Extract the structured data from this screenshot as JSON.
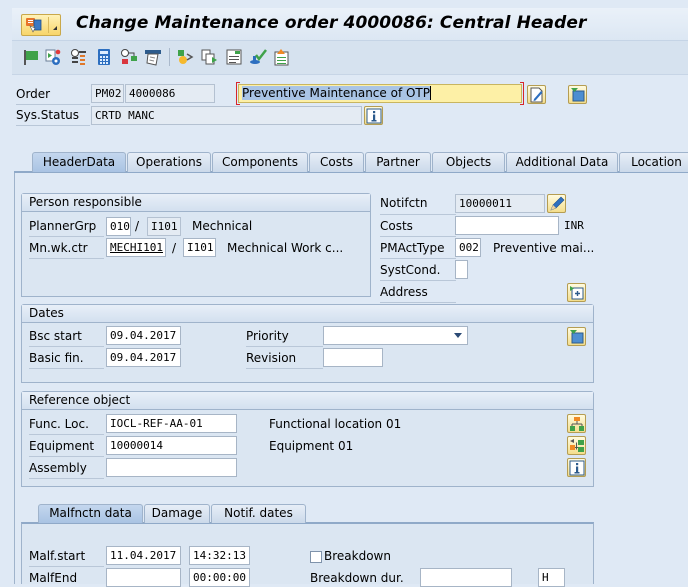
{
  "window": {
    "title": "Change Maintenance order 4000086: Central Header"
  },
  "toolbar": {
    "icons": [
      "flag-icon",
      "settings-gear-icon",
      "list-icon",
      "calculator-icon",
      "transfer-icon",
      "print-icon",
      "process-icon",
      "copy-icon",
      "document-icon",
      "approve-icon",
      "upload-document-icon"
    ]
  },
  "header": {
    "order_label": "Order",
    "order_type": "PM02",
    "order_number": "4000086",
    "order_description": "Preventive Maintenance of OTP",
    "sys_status_label": "Sys.Status",
    "sys_status_value": "CRTD MANC"
  },
  "tabs": [
    {
      "label": "HeaderData",
      "active": true
    },
    {
      "label": "Operations",
      "active": false
    },
    {
      "label": "Components",
      "active": false
    },
    {
      "label": "Costs",
      "active": false
    },
    {
      "label": "Partner",
      "active": false
    },
    {
      "label": "Objects",
      "active": false
    },
    {
      "label": "Additional Data",
      "active": false
    },
    {
      "label": "Location",
      "active": false
    }
  ],
  "person_responsible": {
    "title": "Person responsible",
    "planner_grp_label": "PlannerGrp",
    "planner_grp_value": "010",
    "planner_plant": "I101",
    "planner_desc": "Mechnical",
    "work_ctr_label": "Mn.wk.ctr",
    "work_ctr_value": "MECHI101",
    "work_ctr_plant": "I101",
    "work_ctr_desc": "Mechnical Work c...",
    "separator": "/"
  },
  "notification": {
    "notifctn_label": "Notifctn",
    "notifctn_value": "10000011",
    "costs_label": "Costs",
    "costs_value": "",
    "currency": "INR",
    "pmacttype_label": "PMActType",
    "pmacttype_value": "002",
    "pmacttype_desc": "Preventive mai...",
    "systcond_label": "SystCond.",
    "systcond_value": "",
    "address_label": "Address"
  },
  "dates": {
    "title": "Dates",
    "bsc_start_label": "Bsc start",
    "bsc_start_value": "09.04.2017",
    "basic_fin_label": "Basic fin.",
    "basic_fin_value": "09.04.2017",
    "priority_label": "Priority",
    "priority_value": "",
    "revision_label": "Revision",
    "revision_value": ""
  },
  "reference_object": {
    "title": "Reference object",
    "func_loc_label": "Func. Loc.",
    "func_loc_value": "IOCL-REF-AA-01",
    "func_loc_desc": "Functional location 01",
    "equipment_label": "Equipment",
    "equipment_value": "10000014",
    "equipment_desc": "Equipment 01",
    "assembly_label": "Assembly",
    "assembly_value": ""
  },
  "subtabs": [
    {
      "label": "Malfnctn data",
      "active": true
    },
    {
      "label": "Damage",
      "active": false
    },
    {
      "label": "Notif. dates",
      "active": false
    }
  ],
  "malfunction": {
    "malf_start_label": "Malf.start",
    "malf_start_date": "11.04.2017",
    "malf_start_time": "14:32:13",
    "malf_end_label": "MalfEnd",
    "malf_end_date": "",
    "malf_end_time": "00:00:00",
    "breakdown_label": "Breakdown",
    "breakdown_checked": false,
    "breakdown_dur_label": "Breakdown dur.",
    "breakdown_dur_value": "",
    "breakdown_unit": "H"
  }
}
